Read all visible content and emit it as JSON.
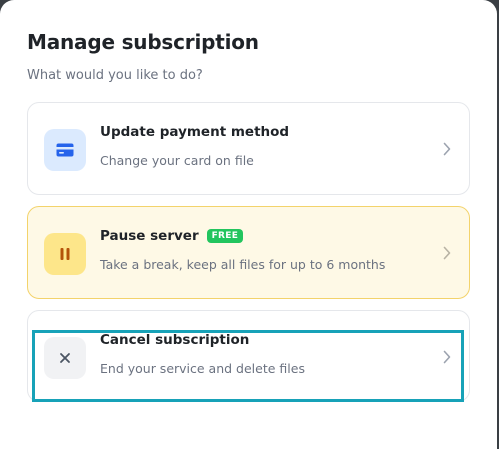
{
  "dialog": {
    "title": "Manage subscription",
    "subtitle": "What would you like to do?"
  },
  "options": [
    {
      "title": "Update payment method",
      "description": "Change your card on file",
      "icon": "credit-card-icon",
      "icon_color": "#2563eb",
      "icon_bg": "#dbeafe"
    },
    {
      "title": "Pause server",
      "badge": "FREE",
      "description": "Take a break, keep all files for up to 6 months",
      "icon": "pause-icon",
      "icon_color": "#b45309",
      "icon_bg": "#fde68a"
    },
    {
      "title": "Cancel subscription",
      "description": "End your service and delete files",
      "icon": "close-icon",
      "icon_color": "#4b5563",
      "icon_bg": "#f1f2f4"
    }
  ],
  "colors": {
    "badge_bg": "#22c55e",
    "highlight": "#17a2b8",
    "pause_card_bg": "#fef9e6",
    "pause_card_border": "#f3d36b"
  }
}
